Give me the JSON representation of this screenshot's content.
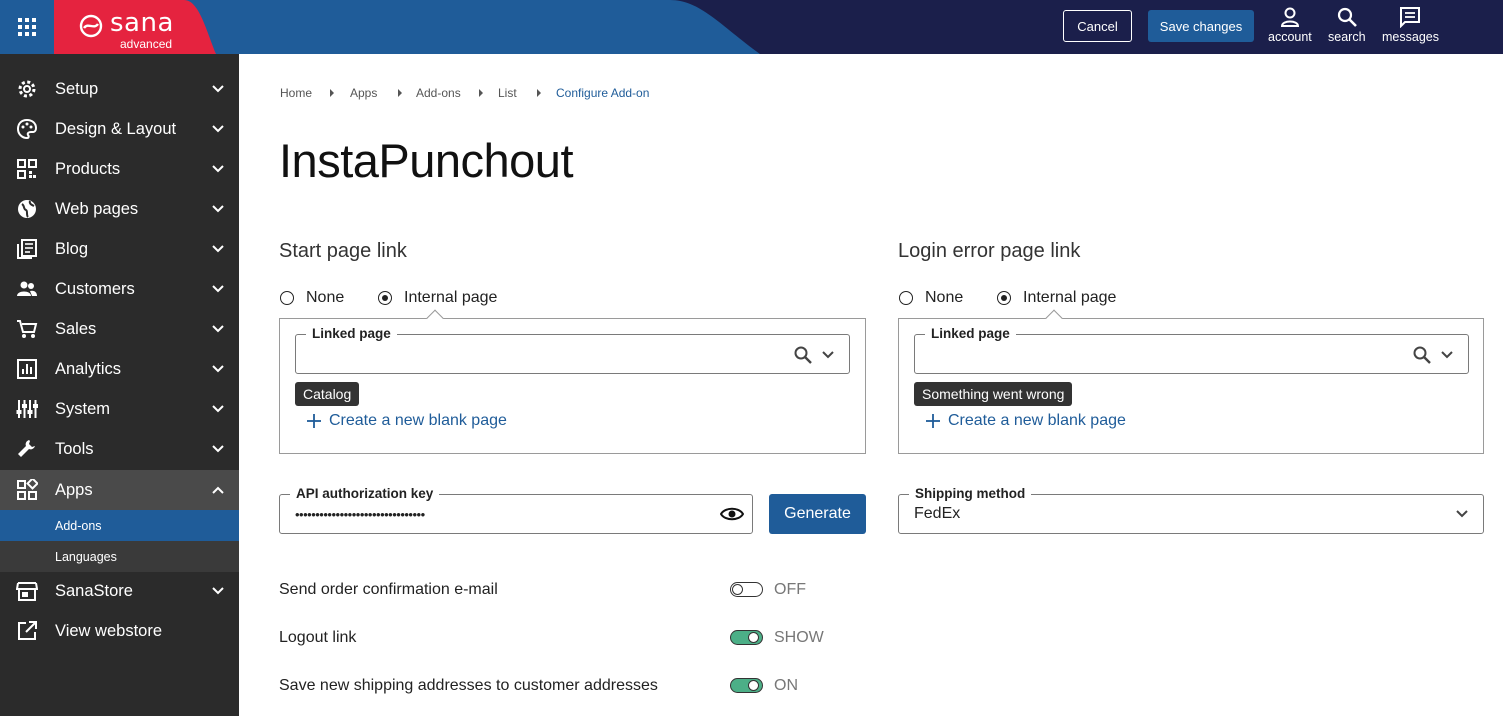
{
  "header": {
    "brand": "sana",
    "brand_sub": "advanced",
    "cancel_label": "Cancel",
    "save_label": "Save changes",
    "icons": [
      {
        "name": "account-icon",
        "label": "account"
      },
      {
        "name": "search-icon",
        "label": "search"
      },
      {
        "name": "messages-icon",
        "label": "messages"
      }
    ],
    "colors": {
      "bar": "#1b1f4b",
      "brand_red": "#e5233f",
      "accent": "#1f5c99"
    }
  },
  "sidebar": {
    "items": [
      {
        "label": "Setup",
        "icon": "gear-icon"
      },
      {
        "label": "Design & Layout",
        "icon": "palette-icon"
      },
      {
        "label": "Products",
        "icon": "qr-grid-icon"
      },
      {
        "label": "Web pages",
        "icon": "globe-icon"
      },
      {
        "label": "Blog",
        "icon": "blog-icon"
      },
      {
        "label": "Customers",
        "icon": "people-icon"
      },
      {
        "label": "Sales",
        "icon": "cart-icon"
      },
      {
        "label": "Analytics",
        "icon": "chart-icon"
      },
      {
        "label": "System",
        "icon": "sliders-icon"
      },
      {
        "label": "Tools",
        "icon": "wrench-icon"
      },
      {
        "label": "Apps",
        "icon": "apps-icon"
      }
    ],
    "sub_items": [
      {
        "label": "Add-ons"
      },
      {
        "label": "Languages"
      }
    ],
    "bottom_items": [
      {
        "label": "SanaStore",
        "icon": "store-icon"
      },
      {
        "label": "View webstore",
        "icon": "external-link-icon"
      }
    ]
  },
  "breadcrumb": [
    "Home",
    "Apps",
    "Add-ons",
    "List",
    "Configure Add-on"
  ],
  "page_title": "InstaPunchout",
  "start_link": {
    "title": "Start page link",
    "option_none": "None",
    "option_internal": "Internal page",
    "linked_label": "Linked page",
    "chip": "Catalog",
    "create_label": "Create a new blank page"
  },
  "error_link": {
    "title": "Login error page link",
    "option_none": "None",
    "option_internal": "Internal page",
    "linked_label": "Linked page",
    "chip": "Something went wrong",
    "create_label": "Create a new blank page"
  },
  "api_key": {
    "label": "API authorization key",
    "masked": "••••••••••••••••••••••••••••••••",
    "generate_label": "Generate"
  },
  "shipping": {
    "label": "Shipping method",
    "value": "FedEx"
  },
  "toggles": [
    {
      "label": "Send order confirmation e-mail",
      "state": "OFF",
      "on": false
    },
    {
      "label": "Logout link",
      "state": "SHOW",
      "on": true
    },
    {
      "label": "Save new shipping addresses to customer addresses",
      "state": "ON",
      "on": true
    }
  ]
}
